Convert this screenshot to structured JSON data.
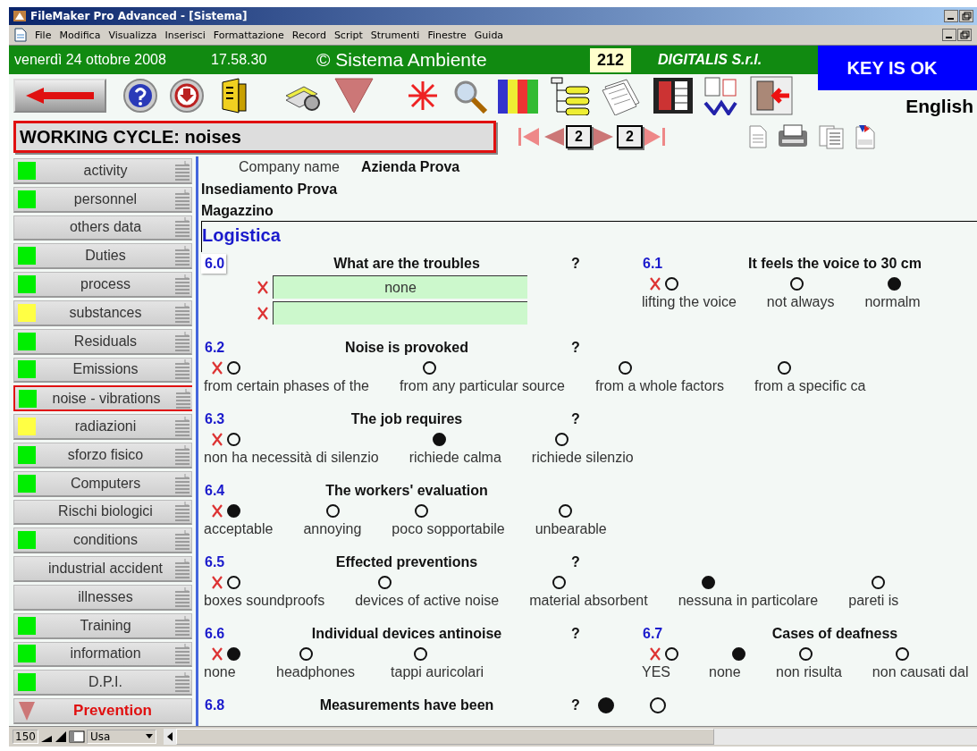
{
  "window": {
    "title": "FileMaker Pro Advanced - [Sistema]"
  },
  "menu": [
    "File",
    "Modifica",
    "Visualizza",
    "Inserisci",
    "Formattazione",
    "Record",
    "Script",
    "Strumenti",
    "Finestre",
    "Guida"
  ],
  "header": {
    "date": "venerdì 24 ottobre 2008",
    "time": "17.58.30",
    "title": "© Sistema Ambiente",
    "record_number": "212",
    "company": "DIGITALIS S.r.l.",
    "key_status": "KEY IS OK"
  },
  "toolbar": {
    "language": "English"
  },
  "layout_title": "WORKING CYCLE: noises",
  "navigation": {
    "current": "2",
    "total": "2"
  },
  "sidebar": {
    "items": [
      {
        "label": "activity",
        "color": "#00ee00",
        "selected": false,
        "kind": "section"
      },
      {
        "label": "personnel",
        "color": "#00ee00",
        "selected": false,
        "kind": "section"
      },
      {
        "label": "others data",
        "selected": false,
        "kind": "section"
      },
      {
        "label": "Duties",
        "color": "#00ee00",
        "selected": false,
        "kind": "section"
      },
      {
        "label": "process",
        "color": "#00ee00",
        "selected": false,
        "kind": "section"
      },
      {
        "label": "substances",
        "color": "#ffff44",
        "selected": false,
        "kind": "section"
      },
      {
        "label": "Residuals",
        "color": "#00ee00",
        "selected": false,
        "kind": "section"
      },
      {
        "label": "Emissions",
        "color": "#00ee00",
        "selected": false,
        "kind": "section"
      },
      {
        "label": "noise - vibrations",
        "color": "#00ee00",
        "selected": true,
        "kind": "section"
      },
      {
        "label": "radiazioni",
        "color": "#ffff44",
        "selected": false,
        "kind": "section"
      },
      {
        "label": "sforzo fisico",
        "color": "#00ee00",
        "selected": false,
        "kind": "section"
      },
      {
        "label": "Computers",
        "color": "#00ee00",
        "selected": false,
        "kind": "section"
      },
      {
        "label": "Rischi biologici",
        "selected": false,
        "kind": "section"
      },
      {
        "label": "conditions",
        "color": "#00ee00",
        "selected": false,
        "kind": "section"
      },
      {
        "label": "industrial accident",
        "selected": false,
        "kind": "section"
      },
      {
        "label": "illnesses",
        "selected": false,
        "kind": "section"
      },
      {
        "label": "Training",
        "color": "#00ee00",
        "selected": false,
        "kind": "section"
      },
      {
        "label": "information",
        "color": "#00ee00",
        "selected": false,
        "kind": "section"
      },
      {
        "label": "D.P.I.",
        "color": "#00ee00",
        "selected": false,
        "kind": "section"
      },
      {
        "label": "Prevention",
        "selected": false,
        "kind": "action"
      }
    ]
  },
  "record": {
    "company_label": "Company name",
    "company": "Azienda Prova",
    "site": "Insediamento Prova",
    "department": "Magazzino",
    "area": "Logistica"
  },
  "rows": [
    {
      "questions": [
        {
          "number": "6.0",
          "title": "What are the troubles",
          "help": "?",
          "kind": "text",
          "clearable": true,
          "fields": [
            {
              "kind": "text",
              "value": "none"
            },
            {
              "kind": "text"
            }
          ]
        },
        {
          "number": "6.1",
          "title": "It feels the voice to 30 cm",
          "kind": "choice",
          "clearable": true,
          "options": [
            {
              "label": "lifting the voice",
              "selected": false
            },
            {
              "label": "not always",
              "selected": false
            },
            {
              "label": "normalm",
              "selected": true
            }
          ]
        }
      ]
    },
    {
      "questions": [
        {
          "number": "6.2",
          "title": "Noise is provoked",
          "help": "?",
          "kind": "choice",
          "clearable": true,
          "options": [
            {
              "label": "from certain phases of the",
              "selected": false
            },
            {
              "label": "from any particular source",
              "selected": false
            },
            {
              "label": "from a whole factors",
              "selected": false
            },
            {
              "label": "from a specific ca",
              "selected": false
            }
          ]
        }
      ]
    },
    {
      "questions": [
        {
          "number": "6.3",
          "title": "The job requires",
          "help": "?",
          "kind": "choice",
          "clearable": true,
          "options": [
            {
              "label": "non ha necessità di silenzio",
              "selected": false
            },
            {
              "label": "richiede calma",
              "selected": true
            },
            {
              "label": "richiede silenzio",
              "selected": false
            }
          ]
        }
      ]
    },
    {
      "questions": [
        {
          "number": "6.4",
          "title": "The workers' evaluation",
          "kind": "choice",
          "clearable": true,
          "options": [
            {
              "label": "acceptable",
              "selected": true
            },
            {
              "label": "annoying",
              "selected": false
            },
            {
              "label": "poco sopportabile",
              "selected": false
            },
            {
              "label": "unbearable",
              "selected": false
            }
          ]
        }
      ]
    },
    {
      "questions": [
        {
          "number": "6.5",
          "title": "Effected preventions",
          "help": "?",
          "kind": "choice",
          "clearable": true,
          "options": [
            {
              "label": "boxes soundproofs",
              "selected": false
            },
            {
              "label": "devices of active noise",
              "selected": false
            },
            {
              "label": "material absorbent",
              "selected": false
            },
            {
              "label": "nessuna in particolare",
              "selected": true
            },
            {
              "label": "pareti is",
              "selected": false
            }
          ]
        }
      ]
    },
    {
      "questions": [
        {
          "number": "6.6",
          "title": "Individual devices antinoise",
          "help": "?",
          "kind": "choice",
          "clearable": true,
          "options": [
            {
              "label": "none",
              "selected": true
            },
            {
              "label": "headphones",
              "selected": false
            },
            {
              "label": "tappi auricolari",
              "selected": false
            }
          ]
        },
        {
          "number": "6.7",
          "title": "Cases of deafness",
          "kind": "choice",
          "clearable": true,
          "options": [
            {
              "label": "YES",
              "selected": false
            },
            {
              "label": "none",
              "selected": true
            },
            {
              "label": "non risulta",
              "selected": false
            },
            {
              "label": "non causati dal",
              "selected": false
            }
          ]
        }
      ]
    },
    {
      "questions": [
        {
          "number": "6.8",
          "title": "Measurements have been",
          "help": "?",
          "kind": "inline",
          "clearable": false,
          "options": [
            {
              "selected": true
            },
            {
              "selected": false
            }
          ]
        }
      ]
    }
  ],
  "status_bar": {
    "zoom": "150",
    "mode": "Usa"
  }
}
